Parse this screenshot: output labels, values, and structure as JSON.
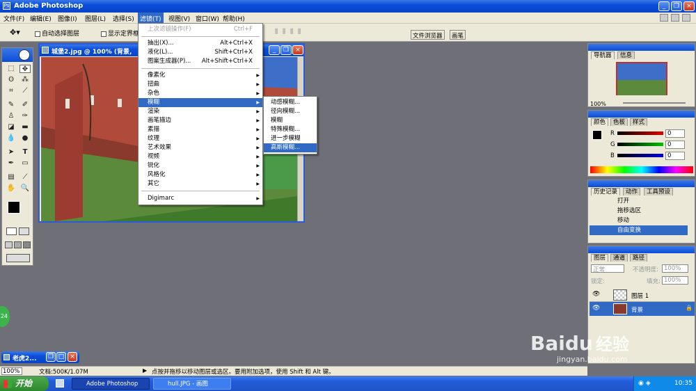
{
  "app": {
    "title": "Adobe Photoshop"
  },
  "menubar": [
    {
      "label": "文件(F)"
    },
    {
      "label": "编辑(E)"
    },
    {
      "label": "图像(I)"
    },
    {
      "label": "图层(L)"
    },
    {
      "label": "选择(S)"
    },
    {
      "label": "滤镜(T)"
    },
    {
      "label": "视图(V)"
    },
    {
      "label": "窗口(W)"
    },
    {
      "label": "帮助(H)"
    }
  ],
  "options": {
    "auto_select": "自动选择图层",
    "show_bounds": "显示定界框"
  },
  "dock_tabs": {
    "file_browser": "文件浏览器",
    "brushes": "画笔"
  },
  "filter_menu": {
    "last_filter": {
      "label": "上次滤镜操作(F)",
      "shortcut": "Ctrl+F"
    },
    "extract": {
      "label": "抽出(X)...",
      "shortcut": "Alt+Ctrl+X"
    },
    "liquify": {
      "label": "液化(L)...",
      "shortcut": "Shift+Ctrl+X"
    },
    "pattern": {
      "label": "图案生成器(P)...",
      "shortcut": "Alt+Shift+Ctrl+X"
    },
    "groups": [
      "像素化",
      "扭曲",
      "杂色",
      "模糊",
      "渲染",
      "画笔描边",
      "素描",
      "纹理",
      "艺术效果",
      "视频",
      "锐化",
      "风格化",
      "其它"
    ],
    "digimarc": "Digimarc"
  },
  "blur_submenu": [
    "动感模糊...",
    "径向模糊...",
    "模糊",
    "特殊模糊...",
    "进一步模糊",
    "高斯模糊..."
  ],
  "document": {
    "title": "城堡2.jpg @ 100% (背景,"
  },
  "minimized_doc": {
    "title": "老虎2..."
  },
  "statusbar": {
    "zoom": "100%",
    "doc_size": "文档:500K/1.07M",
    "hint": "点按并拖移以移动图层或选区。要用附加选项，使用 Shift 和 Alt 键。"
  },
  "navigator": {
    "tabs": [
      "导航器",
      "信息"
    ],
    "zoom": "100%"
  },
  "color_panel": {
    "tabs": [
      "颜色",
      "色板",
      "样式"
    ],
    "channels": [
      {
        "label": "R",
        "value": "0",
        "color": "#e00000"
      },
      {
        "label": "G",
        "value": "0",
        "color": "#00c000"
      },
      {
        "label": "B",
        "value": "0",
        "color": "#0000e0"
      }
    ]
  },
  "history": {
    "tabs": [
      "历史记录",
      "动作",
      "工具预设"
    ],
    "items": [
      "打开",
      "拖移选区",
      "移动",
      "自由变换"
    ]
  },
  "layers": {
    "tabs": [
      "图层",
      "通道",
      "路径"
    ],
    "blend": "正常",
    "opacity_label": "不透明度:",
    "opacity": "100%",
    "lock_label": "锁定:",
    "fill_label": "填充:",
    "fill": "100%",
    "items": [
      "图层 1",
      "背景"
    ]
  },
  "badge": "24",
  "watermark": {
    "brand": "Bai",
    "brand2": "du",
    "jingyan": "经验",
    "url": "jingyan.baidu.com"
  },
  "taskbar": {
    "start": "开始",
    "tasks": [
      "Adobe Photoshop",
      "hull.JPG - 画图"
    ],
    "time": "10:35"
  },
  "colors": {
    "xp_blue": "#0a4dd9",
    "highlight": "#316ac5",
    "workspace": "#6f6f77"
  }
}
